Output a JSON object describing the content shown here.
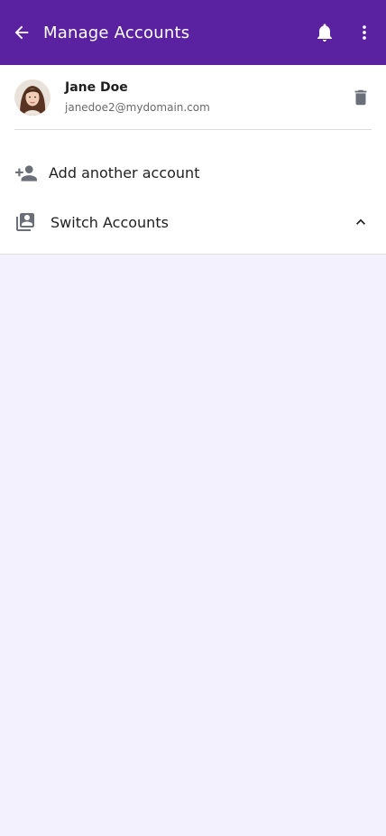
{
  "header": {
    "title": "Manage Accounts",
    "back_icon": "arrow-left-icon",
    "bell_icon": "bell-icon",
    "menu_icon": "more-vert-icon",
    "background_color": "#5a22a0"
  },
  "account": {
    "name": "Jane Doe",
    "email": "janedoe2@mydomain.com",
    "delete_icon": "trash-icon"
  },
  "actions": {
    "add_account_label": "Add another account",
    "add_account_icon": "person-add-icon",
    "switch_accounts_label": "Switch Accounts",
    "switch_accounts_icon": "switch-accounts-icon",
    "switch_toggle_icon": "chevron-up-icon"
  },
  "colors": {
    "page_background": "#f3f1fd",
    "icon_gray": "#6b6f78"
  }
}
